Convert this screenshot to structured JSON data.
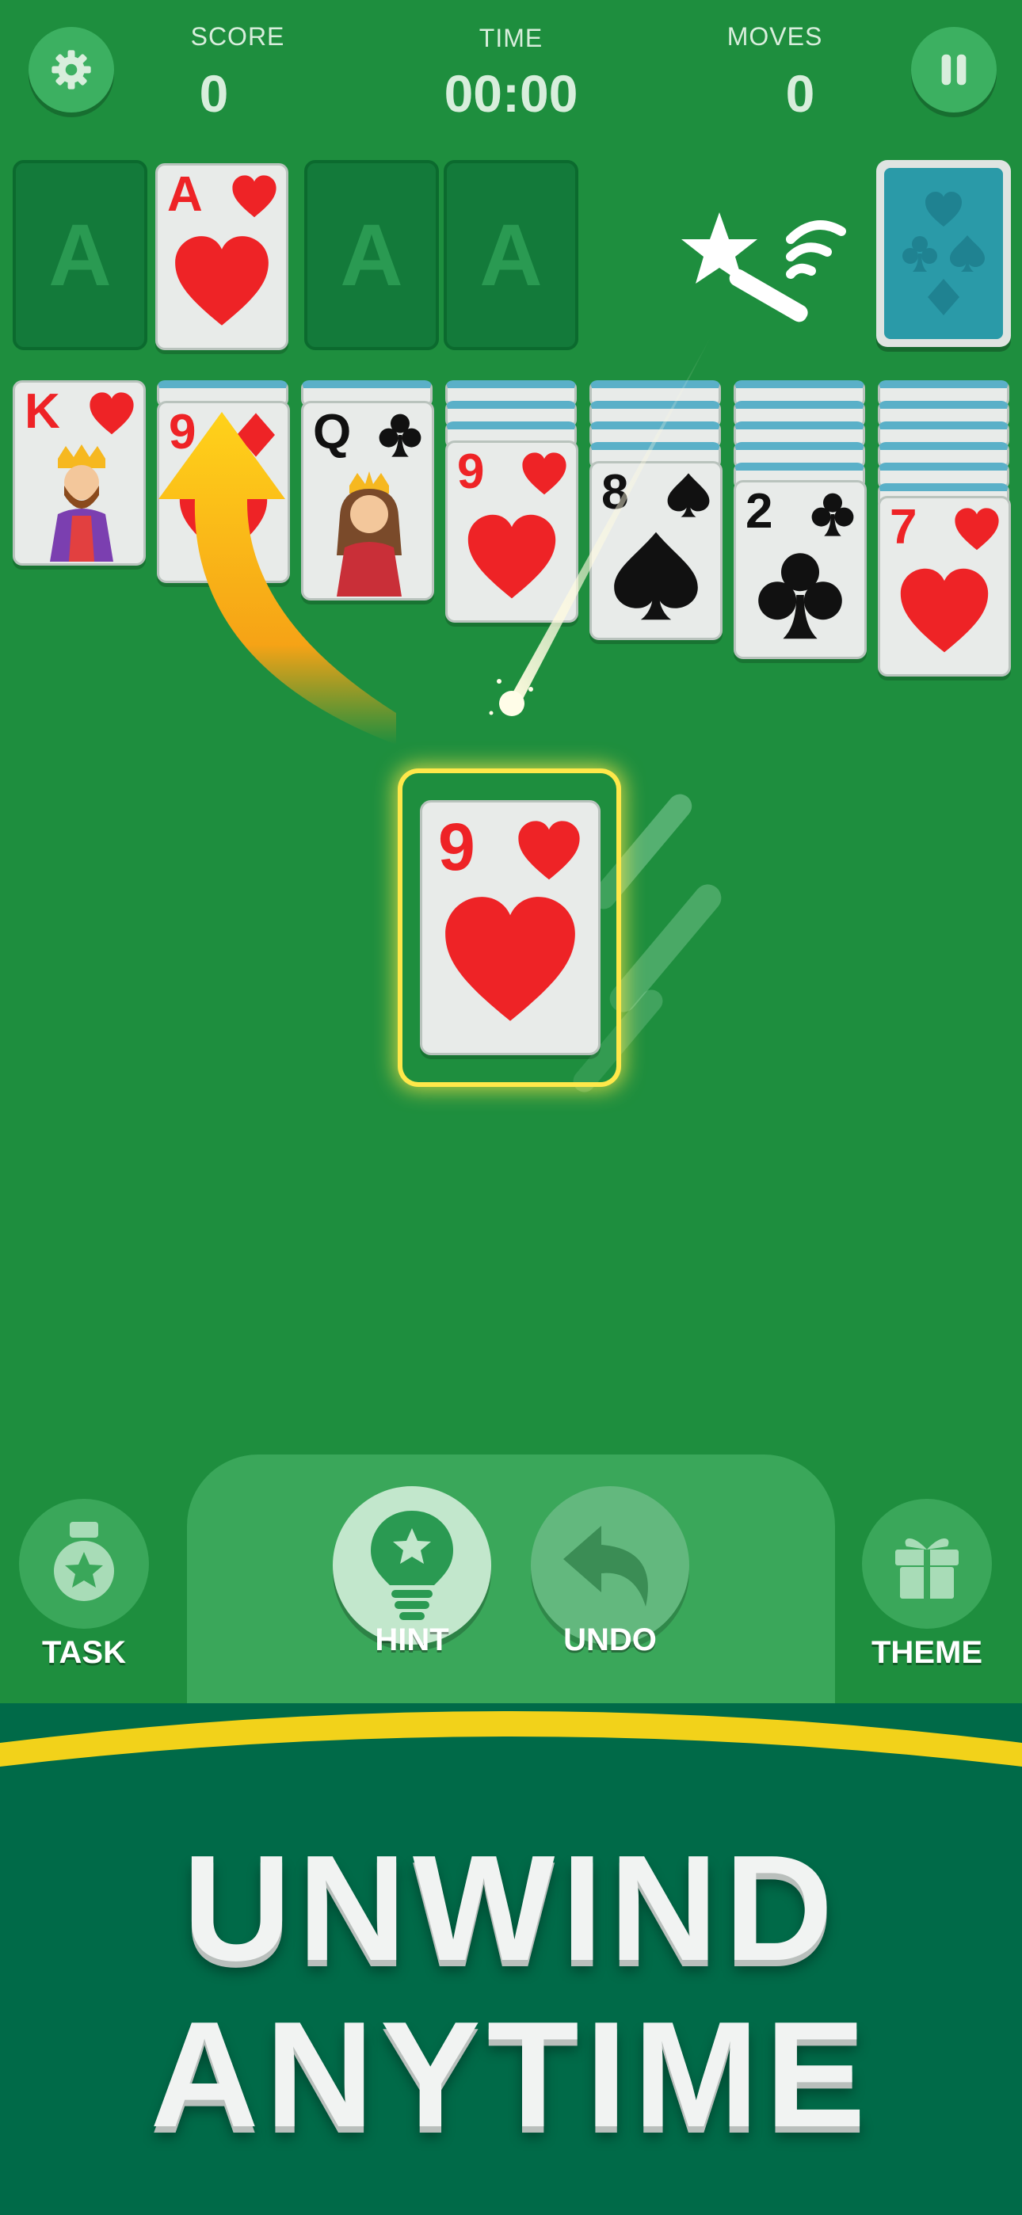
{
  "hud": {
    "score_label": "SCORE",
    "score_value": "0",
    "time_label": "TIME",
    "time_value": "00:00",
    "moves_label": "MOVES",
    "moves_value": "0"
  },
  "foundations": [
    {
      "label": "A",
      "state": "empty"
    },
    {
      "rank": "A",
      "suit": "heart",
      "state": "filled",
      "highlighted": true
    },
    {
      "label": "A",
      "state": "empty"
    },
    {
      "label": "A",
      "state": "empty"
    }
  ],
  "stock": {
    "icon": "card-back"
  },
  "tableau": [
    {
      "rank": "K",
      "suit": "heart",
      "hidden": 0,
      "face": "king"
    },
    {
      "rank": "9",
      "suit": "diamond",
      "hidden": 1
    },
    {
      "rank": "Q",
      "suit": "club",
      "hidden": 1,
      "face": "queen"
    },
    {
      "rank": "9",
      "suit": "heart",
      "hidden": 3
    },
    {
      "rank": "8",
      "suit": "spade",
      "hidden": 4
    },
    {
      "rank": "2",
      "suit": "club",
      "hidden": 5
    },
    {
      "rank": "7",
      "suit": "heart",
      "hidden": 6
    }
  ],
  "dragged_card": {
    "rank": "9",
    "suit": "heart",
    "highlighted": true
  },
  "bottom_bar": {
    "task_label": "TASK",
    "hint_label": "HINT",
    "undo_label": "UNDO",
    "theme_label": "THEME"
  },
  "tagline": {
    "line1": "UNWIND",
    "line2": "ANYTIME"
  },
  "colors": {
    "felt": "#1e8e3e",
    "highlight": "#ffe84a",
    "red_suit": "#ee2326",
    "banner": "#006a48",
    "banner_stripe": "#f2d21a"
  }
}
